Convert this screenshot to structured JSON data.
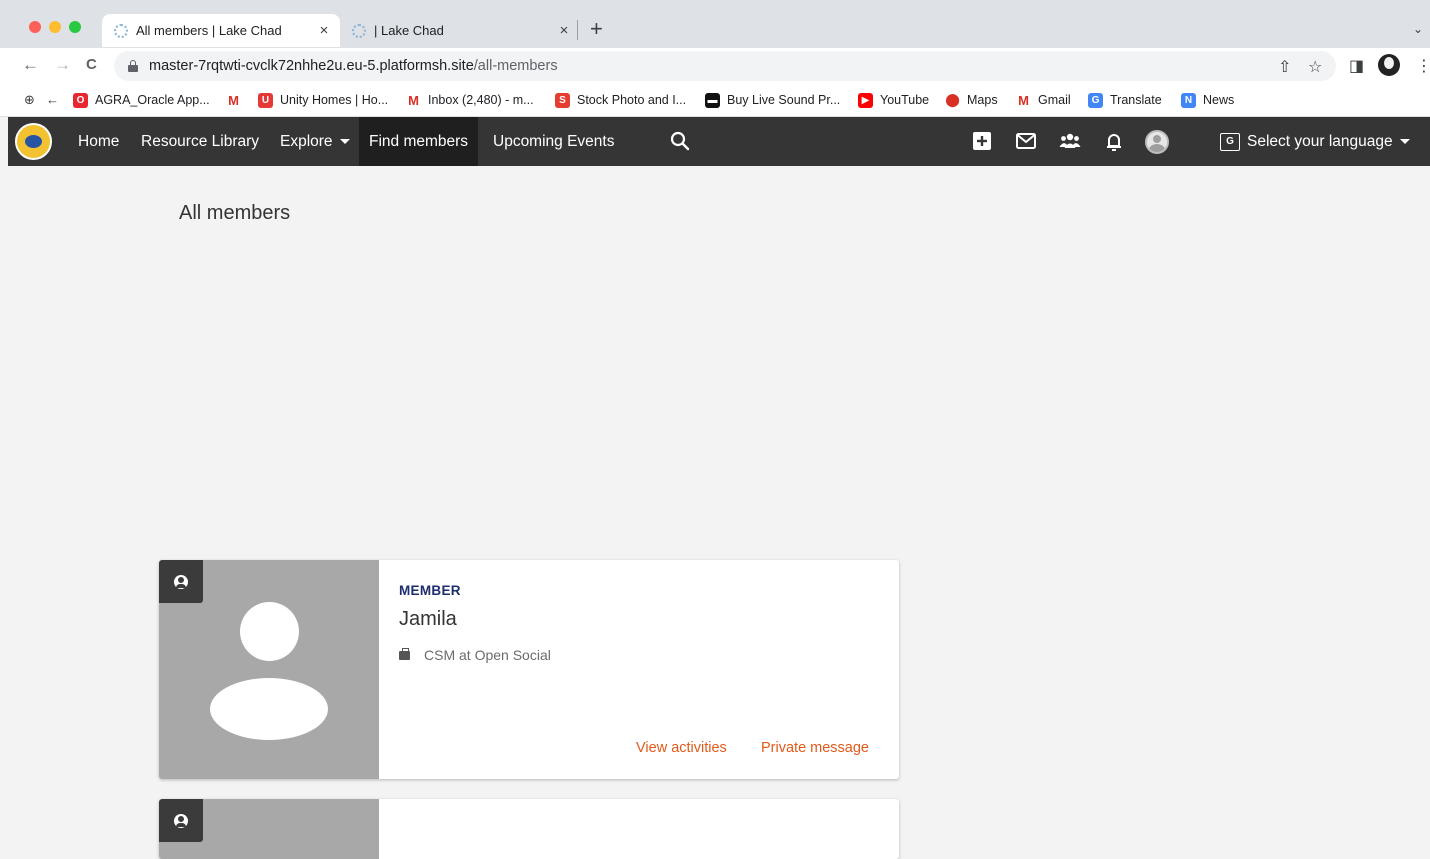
{
  "browser": {
    "tabs": [
      {
        "title": "All members | Lake Chad",
        "close": "×",
        "active": true
      },
      {
        "title": "| Lake Chad",
        "close": "×",
        "active": false
      }
    ],
    "new_tab": "+",
    "tab_menu": "⌄",
    "nav": {
      "back": "←",
      "forward": "→",
      "reload": "C"
    },
    "url": {
      "host": "master-7rqtwti-cvclk72nhhe2u.eu-5.platformsh.site",
      "path": "/all-members"
    },
    "toolbar_icons": {
      "share": "⇧",
      "star": "☆",
      "sidepanel": "◨",
      "menu": "⋮"
    },
    "bookmarks": [
      {
        "label": "AGRA_Oracle App...",
        "icon": "oracle-icon",
        "color": "#e8272e",
        "glyph": "O"
      },
      {
        "label": "",
        "icon": "gmail-icon",
        "color": "#ffffff",
        "glyph": "M"
      },
      {
        "label": "Unity Homes | Ho...",
        "icon": "shield-icon",
        "color": "#e53935",
        "glyph": "U"
      },
      {
        "label": "Inbox (2,480) - m...",
        "icon": "gmail-icon",
        "color": "#ffffff",
        "glyph": "M"
      },
      {
        "label": "Stock Photo and I...",
        "icon": "stock-icon",
        "color": "#e53d2f",
        "glyph": "S"
      },
      {
        "label": "Buy Live Sound Pr...",
        "icon": "store-icon",
        "color": "#111111",
        "glyph": "▬"
      },
      {
        "label": "YouTube",
        "icon": "youtube-icon",
        "color": "#ff0000",
        "glyph": "▶"
      },
      {
        "label": "Maps",
        "icon": "maps-icon",
        "color": "#ffffff",
        "glyph": "⬤"
      },
      {
        "label": "Gmail",
        "icon": "gmail-icon",
        "color": "#ffffff",
        "glyph": "M"
      },
      {
        "label": "Translate",
        "icon": "translate-icon",
        "color": "#4285f4",
        "glyph": "G"
      },
      {
        "label": "News",
        "icon": "news-icon",
        "color": "#4285f4",
        "glyph": "N"
      }
    ]
  },
  "site": {
    "nav": {
      "home": "Home",
      "resource_library": "Resource Library",
      "explore": "Explore",
      "find_members": "Find members",
      "upcoming_events": "Upcoming Events"
    },
    "language": "Select your language"
  },
  "page": {
    "title": "All members",
    "members": [
      {
        "role": "MEMBER",
        "name": "Jamila",
        "job": "CSM at Open Social",
        "view_activities": "View activities",
        "private_message": "Private message"
      }
    ]
  },
  "colors": {
    "nav_bg": "#353535",
    "link_accent": "#e05a19",
    "role_label": "#1d2d6e",
    "page_bg": "#f3f3f3"
  }
}
